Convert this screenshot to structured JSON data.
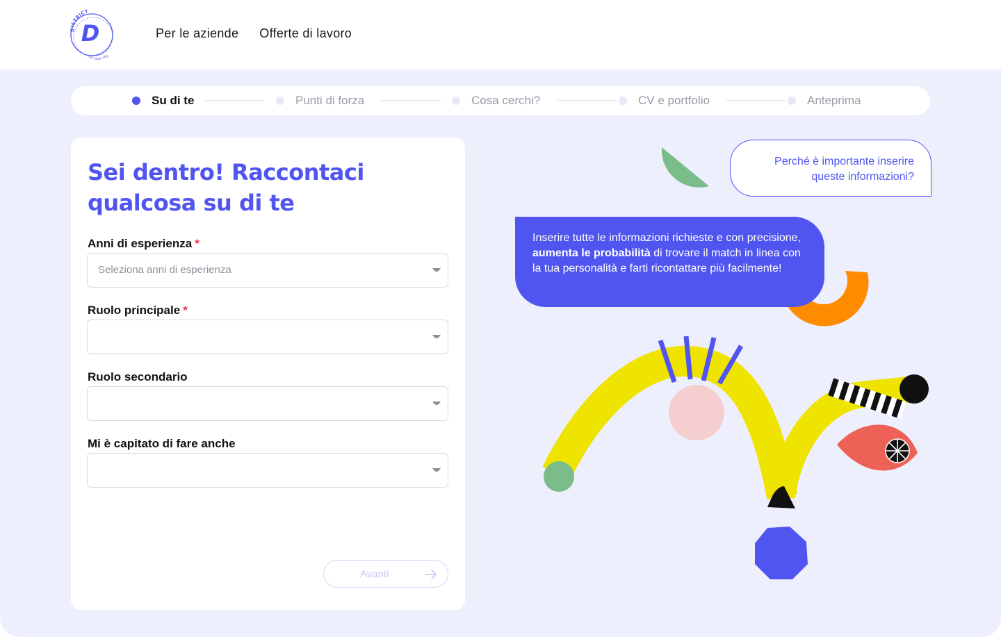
{
  "brand": {
    "logo_letter": "D",
    "logo_text_top": "DISTRICT",
    "logo_text_bottom": "run your city"
  },
  "nav": {
    "items": [
      "Per le aziende",
      "Offerte di lavoro"
    ]
  },
  "stepper": {
    "steps": [
      "Su di te",
      "Punti di forza",
      "Cosa cerchi?",
      "CV e portfolio",
      "Anteprima"
    ],
    "active_index": 0
  },
  "form": {
    "title": "Sei dentro! Raccontaci qualcosa su di te",
    "required_mark": "*",
    "fields": [
      {
        "label": "Anni di esperienza",
        "required": true,
        "placeholder": "Seleziona anni di esperienza"
      },
      {
        "label": "Ruolo principale",
        "required": true,
        "placeholder": ""
      },
      {
        "label": "Ruolo secondario",
        "required": false,
        "placeholder": ""
      },
      {
        "label": "Mi è capitato di fare anche",
        "required": false,
        "placeholder": ""
      }
    ],
    "next_label": "Avanti"
  },
  "help": {
    "question": "Perché è importante inserire queste informazioni?",
    "answer_before": "Inserire tutte le informazioni richieste e con precisione, ",
    "answer_bold": "aumenta le probabilità",
    "answer_after": " di trovare il match in linea con la tua personalità e farti ricontattare più facilmente!"
  },
  "colors": {
    "accent": "#5055f0",
    "required": "#e8344e",
    "background": "#eeeffd",
    "yellow": "#efe300",
    "orange": "#ff8c00",
    "green": "#7bbd8a",
    "pink": "#f5cfd0",
    "coral": "#ee6156"
  }
}
